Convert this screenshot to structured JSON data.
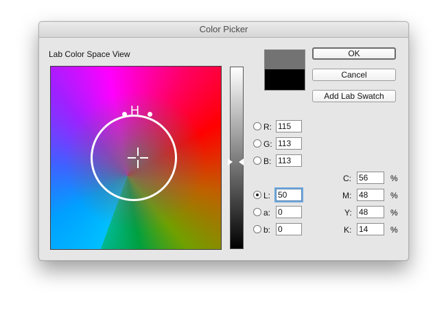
{
  "window": {
    "title": "Color Picker"
  },
  "picker": {
    "section_title": "Lab Color Space View",
    "hue_mark": "H"
  },
  "swatch": {
    "new_color": "#737373",
    "old_color": "#000000"
  },
  "buttons": {
    "ok": "OK",
    "cancel": "Cancel",
    "add_swatch": "Add Lab Swatch"
  },
  "rgb": {
    "r_label": "R:",
    "r_value": "115",
    "g_label": "G:",
    "g_value": "113",
    "b_label": "B:",
    "b_value": "113"
  },
  "lab": {
    "l_label": "L:",
    "l_value": "50",
    "a_label": "a:",
    "a_value": "0",
    "b_label": "b:",
    "b_value": "0",
    "selected": "L"
  },
  "cmyk": {
    "c_label": "C:",
    "c_value": "56",
    "m_label": "M:",
    "m_value": "48",
    "y_label": "Y:",
    "y_value": "48",
    "k_label": "K:",
    "k_value": "14",
    "unit": "%"
  },
  "icons": {
    "crosshair": "crosshair-icon",
    "slider_arrows": "slider-arrow-icon"
  }
}
